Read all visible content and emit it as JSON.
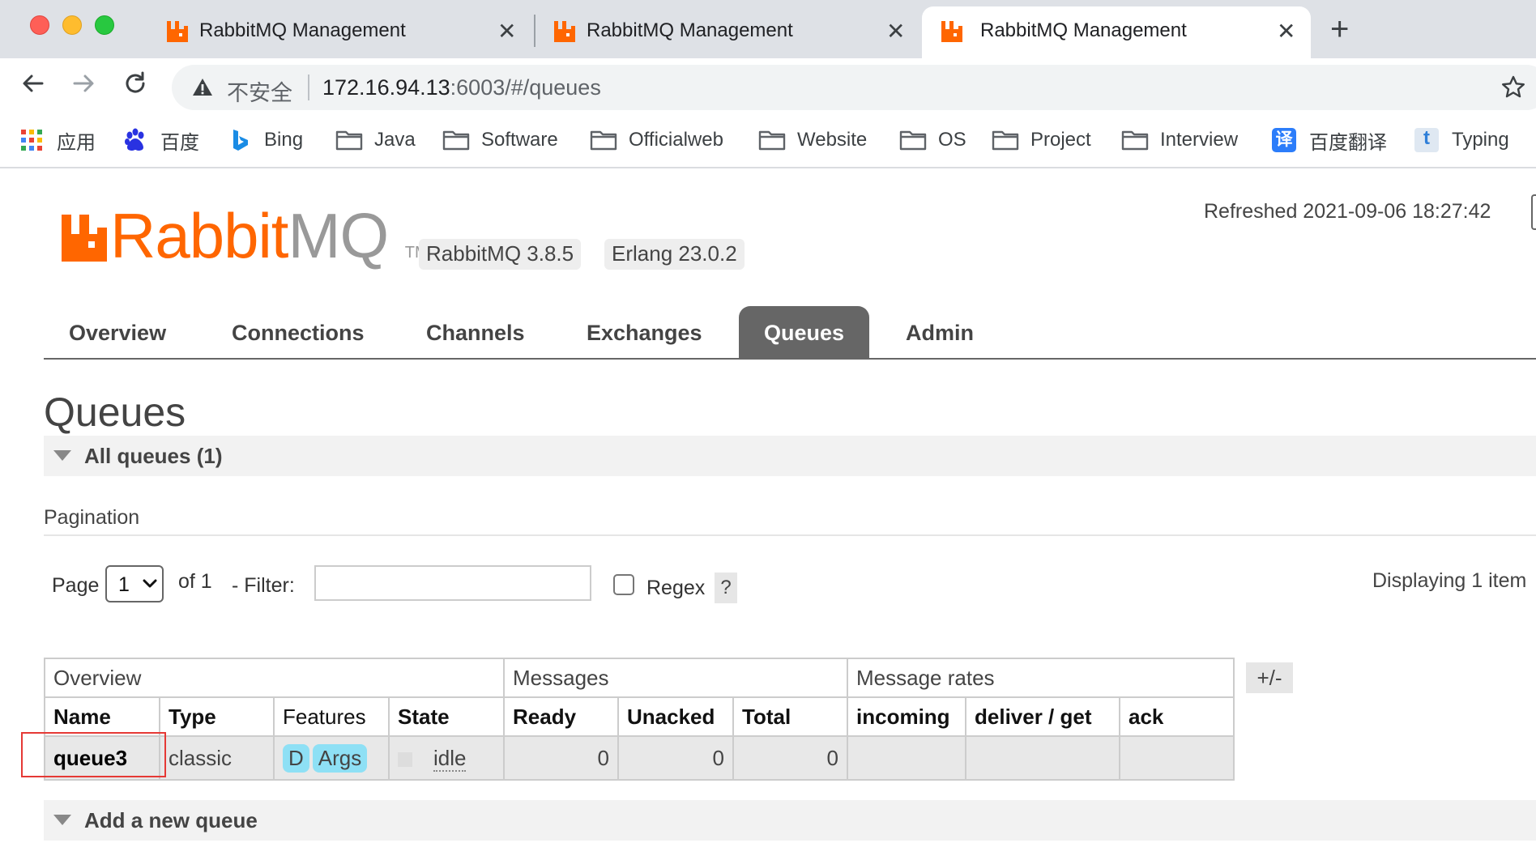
{
  "browser": {
    "tabs": [
      {
        "title": "RabbitMQ Management",
        "active": false
      },
      {
        "title": "RabbitMQ Management",
        "active": false
      },
      {
        "title": "RabbitMQ Management",
        "active": true
      }
    ],
    "close_glyph": "✕",
    "newtab_glyph": "+",
    "address": {
      "security_label": "不安全",
      "host": "172.16.94.13",
      "rest": ":6003/#/queues"
    },
    "bookmarks": [
      {
        "label": "应用",
        "icon": "apps-grid-icon"
      },
      {
        "label": "百度",
        "icon": "baidu-paw-icon"
      },
      {
        "label": "Bing",
        "icon": "bing-icon"
      },
      {
        "label": "Java",
        "icon": "folder-icon"
      },
      {
        "label": "Software",
        "icon": "folder-icon"
      },
      {
        "label": "Officialweb",
        "icon": "folder-icon"
      },
      {
        "label": "Website",
        "icon": "folder-icon"
      },
      {
        "label": "OS",
        "icon": "folder-icon"
      },
      {
        "label": "Project",
        "icon": "folder-icon"
      },
      {
        "label": "Interview",
        "icon": "folder-icon"
      },
      {
        "label": "百度翻译",
        "icon": "baidu-translate-icon"
      },
      {
        "label": "Typing",
        "icon": "typing-icon"
      }
    ],
    "icon_text": {
      "translate": "译",
      "typing": "t"
    }
  },
  "app": {
    "logo_rabbit": "Rabbit",
    "logo_mq": "MQ",
    "logo_tm": "TM",
    "version": "RabbitMQ 3.8.5",
    "erlang": "Erlang 23.0.2",
    "refreshed": "Refreshed 2021-09-06 18:27:42",
    "nav": [
      {
        "label": "Overview",
        "active": false
      },
      {
        "label": "Connections",
        "active": false
      },
      {
        "label": "Channels",
        "active": false
      },
      {
        "label": "Exchanges",
        "active": false
      },
      {
        "label": "Queues",
        "active": true
      },
      {
        "label": "Admin",
        "active": false
      }
    ],
    "colors": {
      "brand": "#ff6600",
      "nav_active": "#666666",
      "feature_badge": "#8ee0f5",
      "highlight": "#e53935"
    }
  },
  "page": {
    "title": "Queues",
    "all_queues": "All queues (1)",
    "pagination": {
      "label": "Pagination",
      "page_label": "Page",
      "page_value": "1",
      "of_label": "of 1",
      "filter_label": "- Filter:",
      "filter_value": "",
      "regex_label": "Regex",
      "regex_checked": false,
      "help": "?",
      "displaying": "Displaying 1 item"
    },
    "table": {
      "groups": [
        "Overview",
        "Messages",
        "Message rates"
      ],
      "columns": [
        "Name",
        "Type",
        "Features",
        "State",
        "Ready",
        "Unacked",
        "Total",
        "incoming",
        "deliver / get",
        "ack"
      ],
      "rows": [
        {
          "name": "queue3",
          "type": "classic",
          "features": [
            "D",
            "Args"
          ],
          "state": "idle",
          "ready": "0",
          "unacked": "0",
          "total": "0",
          "incoming": "",
          "deliver_get": "",
          "ack": ""
        }
      ],
      "toggle_columns": "+/-"
    },
    "add_queue": "Add a new queue"
  }
}
